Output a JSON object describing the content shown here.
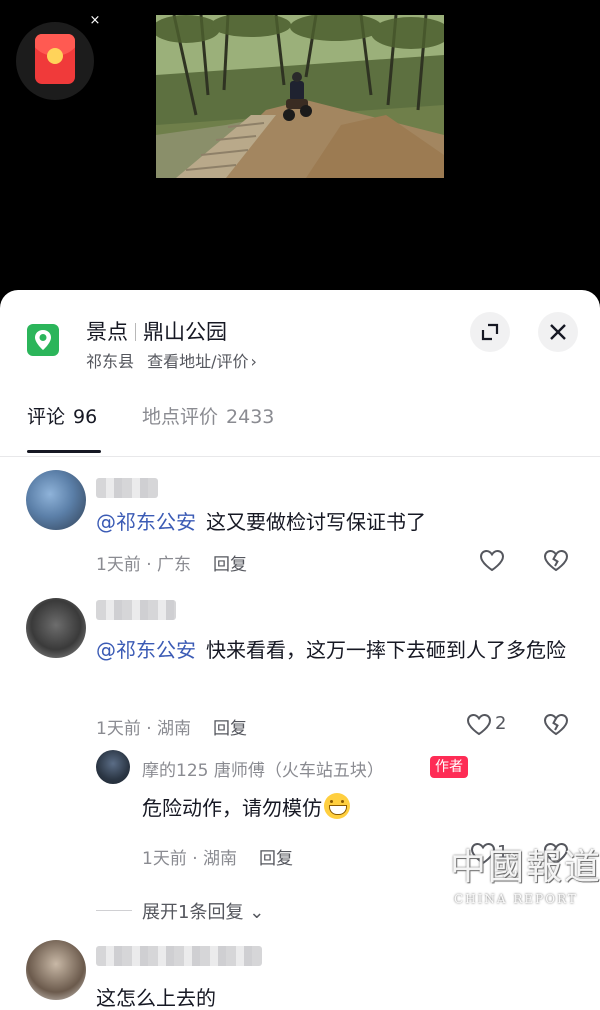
{
  "video": {
    "redpacket_icon": "red-envelope-icon",
    "close_symbol": "×"
  },
  "place": {
    "category": "景点",
    "name": "鼎山公园",
    "county": "祁东县",
    "details_link": "查看地址/评价",
    "details_chevron": "›"
  },
  "tabs": {
    "comments_label": "评论",
    "comments_count": "96",
    "reviews_label": "地点评价",
    "reviews_count": "2433"
  },
  "comments": [
    {
      "mention": "@祁东公安",
      "text": "这又要做检讨写保证书了",
      "time_location": "1天前 · 广东",
      "reply_label": "回复",
      "likes": ""
    },
    {
      "mention": "@祁东公安",
      "text": "快来看看，这万一摔下去砸到人了多危险",
      "time_location": "1天前 · 湖南",
      "reply_label": "回复",
      "likes": "2",
      "reply": {
        "author_name": "摩的125 唐师傅（火车站五块）",
        "badge": "作者",
        "text": "危险动作，请勿模仿",
        "time_location": "1天前 · 湖南",
        "reply_label": "回复",
        "likes": "1"
      },
      "expand_label": "展开1条回复",
      "expand_chevron": "⌄"
    },
    {
      "text": "这怎么上去的"
    }
  ],
  "watermark": {
    "cn": "中國報道",
    "en": "CHINA  REPORT"
  },
  "colors": {
    "accent_pink": "#fe2c55",
    "mention_blue": "#3b5bb5",
    "pin_green": "#2bb55a"
  }
}
